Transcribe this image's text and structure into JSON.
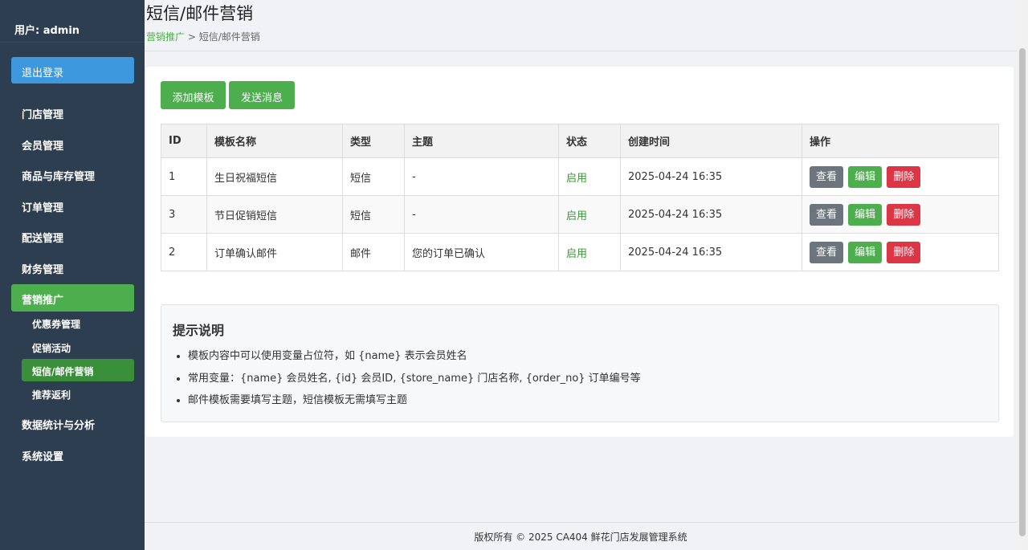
{
  "sidebar": {
    "user_label": "用户: admin",
    "logout": "退出登录",
    "nav": [
      "门店管理",
      "会员管理",
      "商品与库存管理",
      "订单管理",
      "配送管理",
      "财务管理"
    ],
    "active_section": "营销推广",
    "sub_items": [
      "优惠券管理",
      "促销活动",
      "短信/邮件营销",
      "推荐返利"
    ],
    "nav_after": [
      "数据统计与分析",
      "系统设置"
    ]
  },
  "header": {
    "title": "短信/邮件营销",
    "breadcrumb_link": "营销推广",
    "breadcrumb_sep": ">",
    "breadcrumb_current": "短信/邮件营销"
  },
  "actions": {
    "add_template": "添加模板",
    "send_message": "发送消息"
  },
  "table": {
    "headers": [
      "ID",
      "模板名称",
      "类型",
      "主题",
      "状态",
      "创建时间",
      "操作"
    ],
    "rows": [
      {
        "id": "1",
        "name": "生日祝福短信",
        "type": "短信",
        "subject": "-",
        "status": "启用",
        "created": "2025-04-24 16:35"
      },
      {
        "id": "3",
        "name": "节日促销短信",
        "type": "短信",
        "subject": "-",
        "status": "启用",
        "created": "2025-04-24 16:35"
      },
      {
        "id": "2",
        "name": "订单确认邮件",
        "type": "邮件",
        "subject": "您的订单已确认",
        "status": "启用",
        "created": "2025-04-24 16:35"
      }
    ],
    "btn_view": "查看",
    "btn_edit": "编辑",
    "btn_delete": "删除"
  },
  "tips": {
    "title": "提示说明",
    "items": [
      "模板内容中可以使用变量占位符，如 {name} 表示会员姓名",
      "常用变量：{name} 会员姓名, {id} 会员ID, {store_name} 门店名称, {order_no} 订单编号等",
      "邮件模板需要填写主题，短信模板无需填写主题"
    ]
  },
  "footer": "版权所有 © 2025 CA404 鲜花门店发展管理系统",
  "colors": {
    "sidebar_bg": "#2c3e50",
    "primary_blue": "#3d98de",
    "success_green": "#4cae4c",
    "danger_red": "#dc3545",
    "secondary_gray": "#6c757d"
  }
}
